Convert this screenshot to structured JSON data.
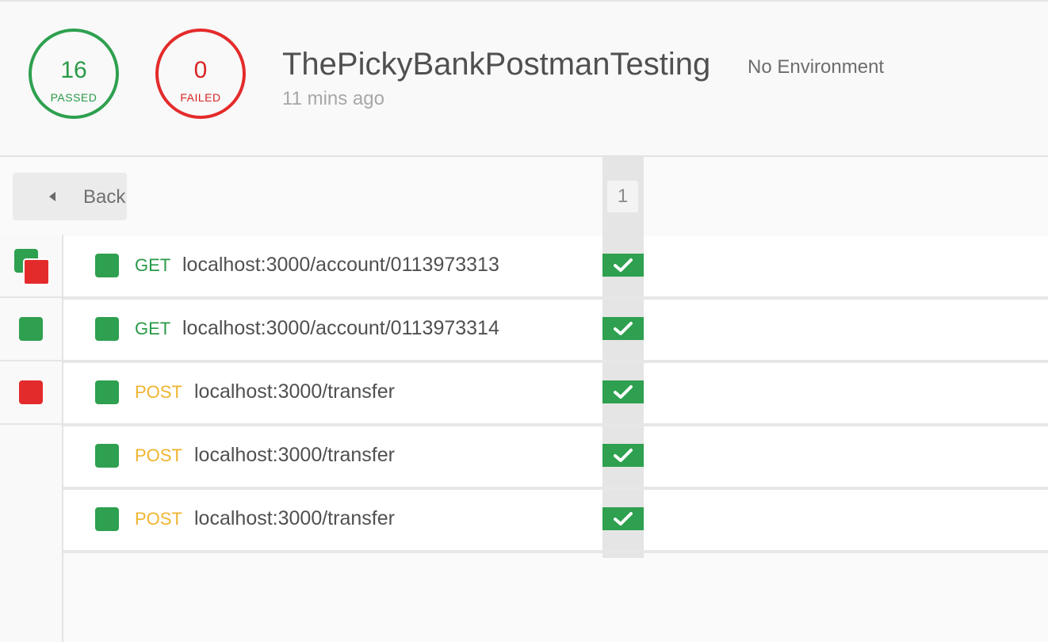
{
  "summary": {
    "passed_count": "16",
    "passed_label": "PASSED",
    "failed_count": "0",
    "failed_label": "FAILED",
    "collection_name": "ThePickyBankPostmanTesting",
    "environment": "No Environment",
    "run_time": "11 mins ago"
  },
  "nav": {
    "back_label": "Back"
  },
  "iterations": [
    "1"
  ],
  "filters": [
    {
      "name": "all",
      "icon": "all-results-icon"
    },
    {
      "name": "passed",
      "icon": "passed-filter-icon"
    },
    {
      "name": "failed",
      "icon": "failed-filter-icon"
    }
  ],
  "requests": [
    {
      "method": "GET",
      "url": "localhost:3000/account/0113973313",
      "status": "pass"
    },
    {
      "method": "GET",
      "url": "localhost:3000/account/0113973314",
      "status": "pass"
    },
    {
      "method": "POST",
      "url": "localhost:3000/transfer",
      "status": "pass"
    },
    {
      "method": "POST",
      "url": "localhost:3000/transfer",
      "status": "pass"
    },
    {
      "method": "POST",
      "url": "localhost:3000/transfer",
      "status": "pass"
    }
  ],
  "colors": {
    "pass": "#2ea04f",
    "fail": "#e42b2b",
    "get": "#2a9a47",
    "post": "#f0b430"
  }
}
